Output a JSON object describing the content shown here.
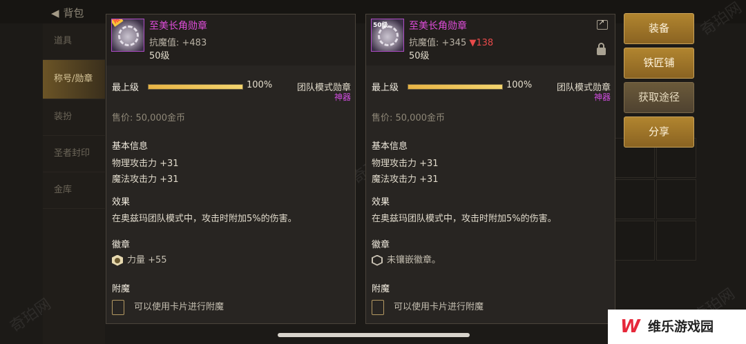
{
  "background": {
    "back_label": "背包",
    "sidebar_items": [
      "道具",
      "称号/勋章",
      "装扮",
      "圣者封印",
      "金库"
    ],
    "active_index": 1
  },
  "actions": {
    "equip": "装备",
    "blacksmith": "铁匠铺",
    "obtain": "获取途径",
    "share": "分享"
  },
  "left_panel": {
    "name": "至美长角勋章",
    "stat_line": "抗魔值: +483",
    "level": "50级",
    "grade_label": "最上级",
    "grade_percent": "100%",
    "grade_fill": 1.0,
    "type": "团队模式勋章",
    "rarity": "神器",
    "price": "售价: 50,000金币",
    "basic_title": "基本信息",
    "basic_lines": [
      "物理攻击力 +31",
      "魔法攻击力 +31"
    ],
    "effect_title": "效果",
    "effect_text": "在奥兹玛团队模式中，攻击时附加5%的伤害。",
    "emblem_title": "徽章",
    "emblem_text": "力量 +55",
    "enchant_title": "附魔",
    "enchant_text": "可以使用卡片进行附魔"
  },
  "right_panel": {
    "name": "至美长角勋章",
    "stat_line": "抗魔值: +345",
    "stat_diff": "▼138",
    "level": "50级",
    "icon_level": "50级",
    "grade_label": "最上级",
    "grade_percent": "100%",
    "grade_fill": 1.0,
    "type": "团队模式勋章",
    "rarity": "神器",
    "price": "售价: 50,000金币",
    "basic_title": "基本信息",
    "basic_lines": [
      "物理攻击力 +31",
      "魔法攻击力 +31"
    ],
    "effect_title": "效果",
    "effect_text": "在奥兹玛团队模式中，攻击时附加5%的伤害。",
    "emblem_title": "徽章",
    "emblem_text": "未镶嵌徽章。",
    "enchant_title": "附魔",
    "enchant_text": "可以使用卡片进行附魔"
  },
  "watermark": "奇珀网",
  "site_logo": {
    "mark": "W",
    "text": "维乐游戏园"
  },
  "colors": {
    "item_name": "#e04ddb",
    "rarity": "#d14de0",
    "button_gold": "#b1852f",
    "stat_down": "#e84a4a"
  }
}
